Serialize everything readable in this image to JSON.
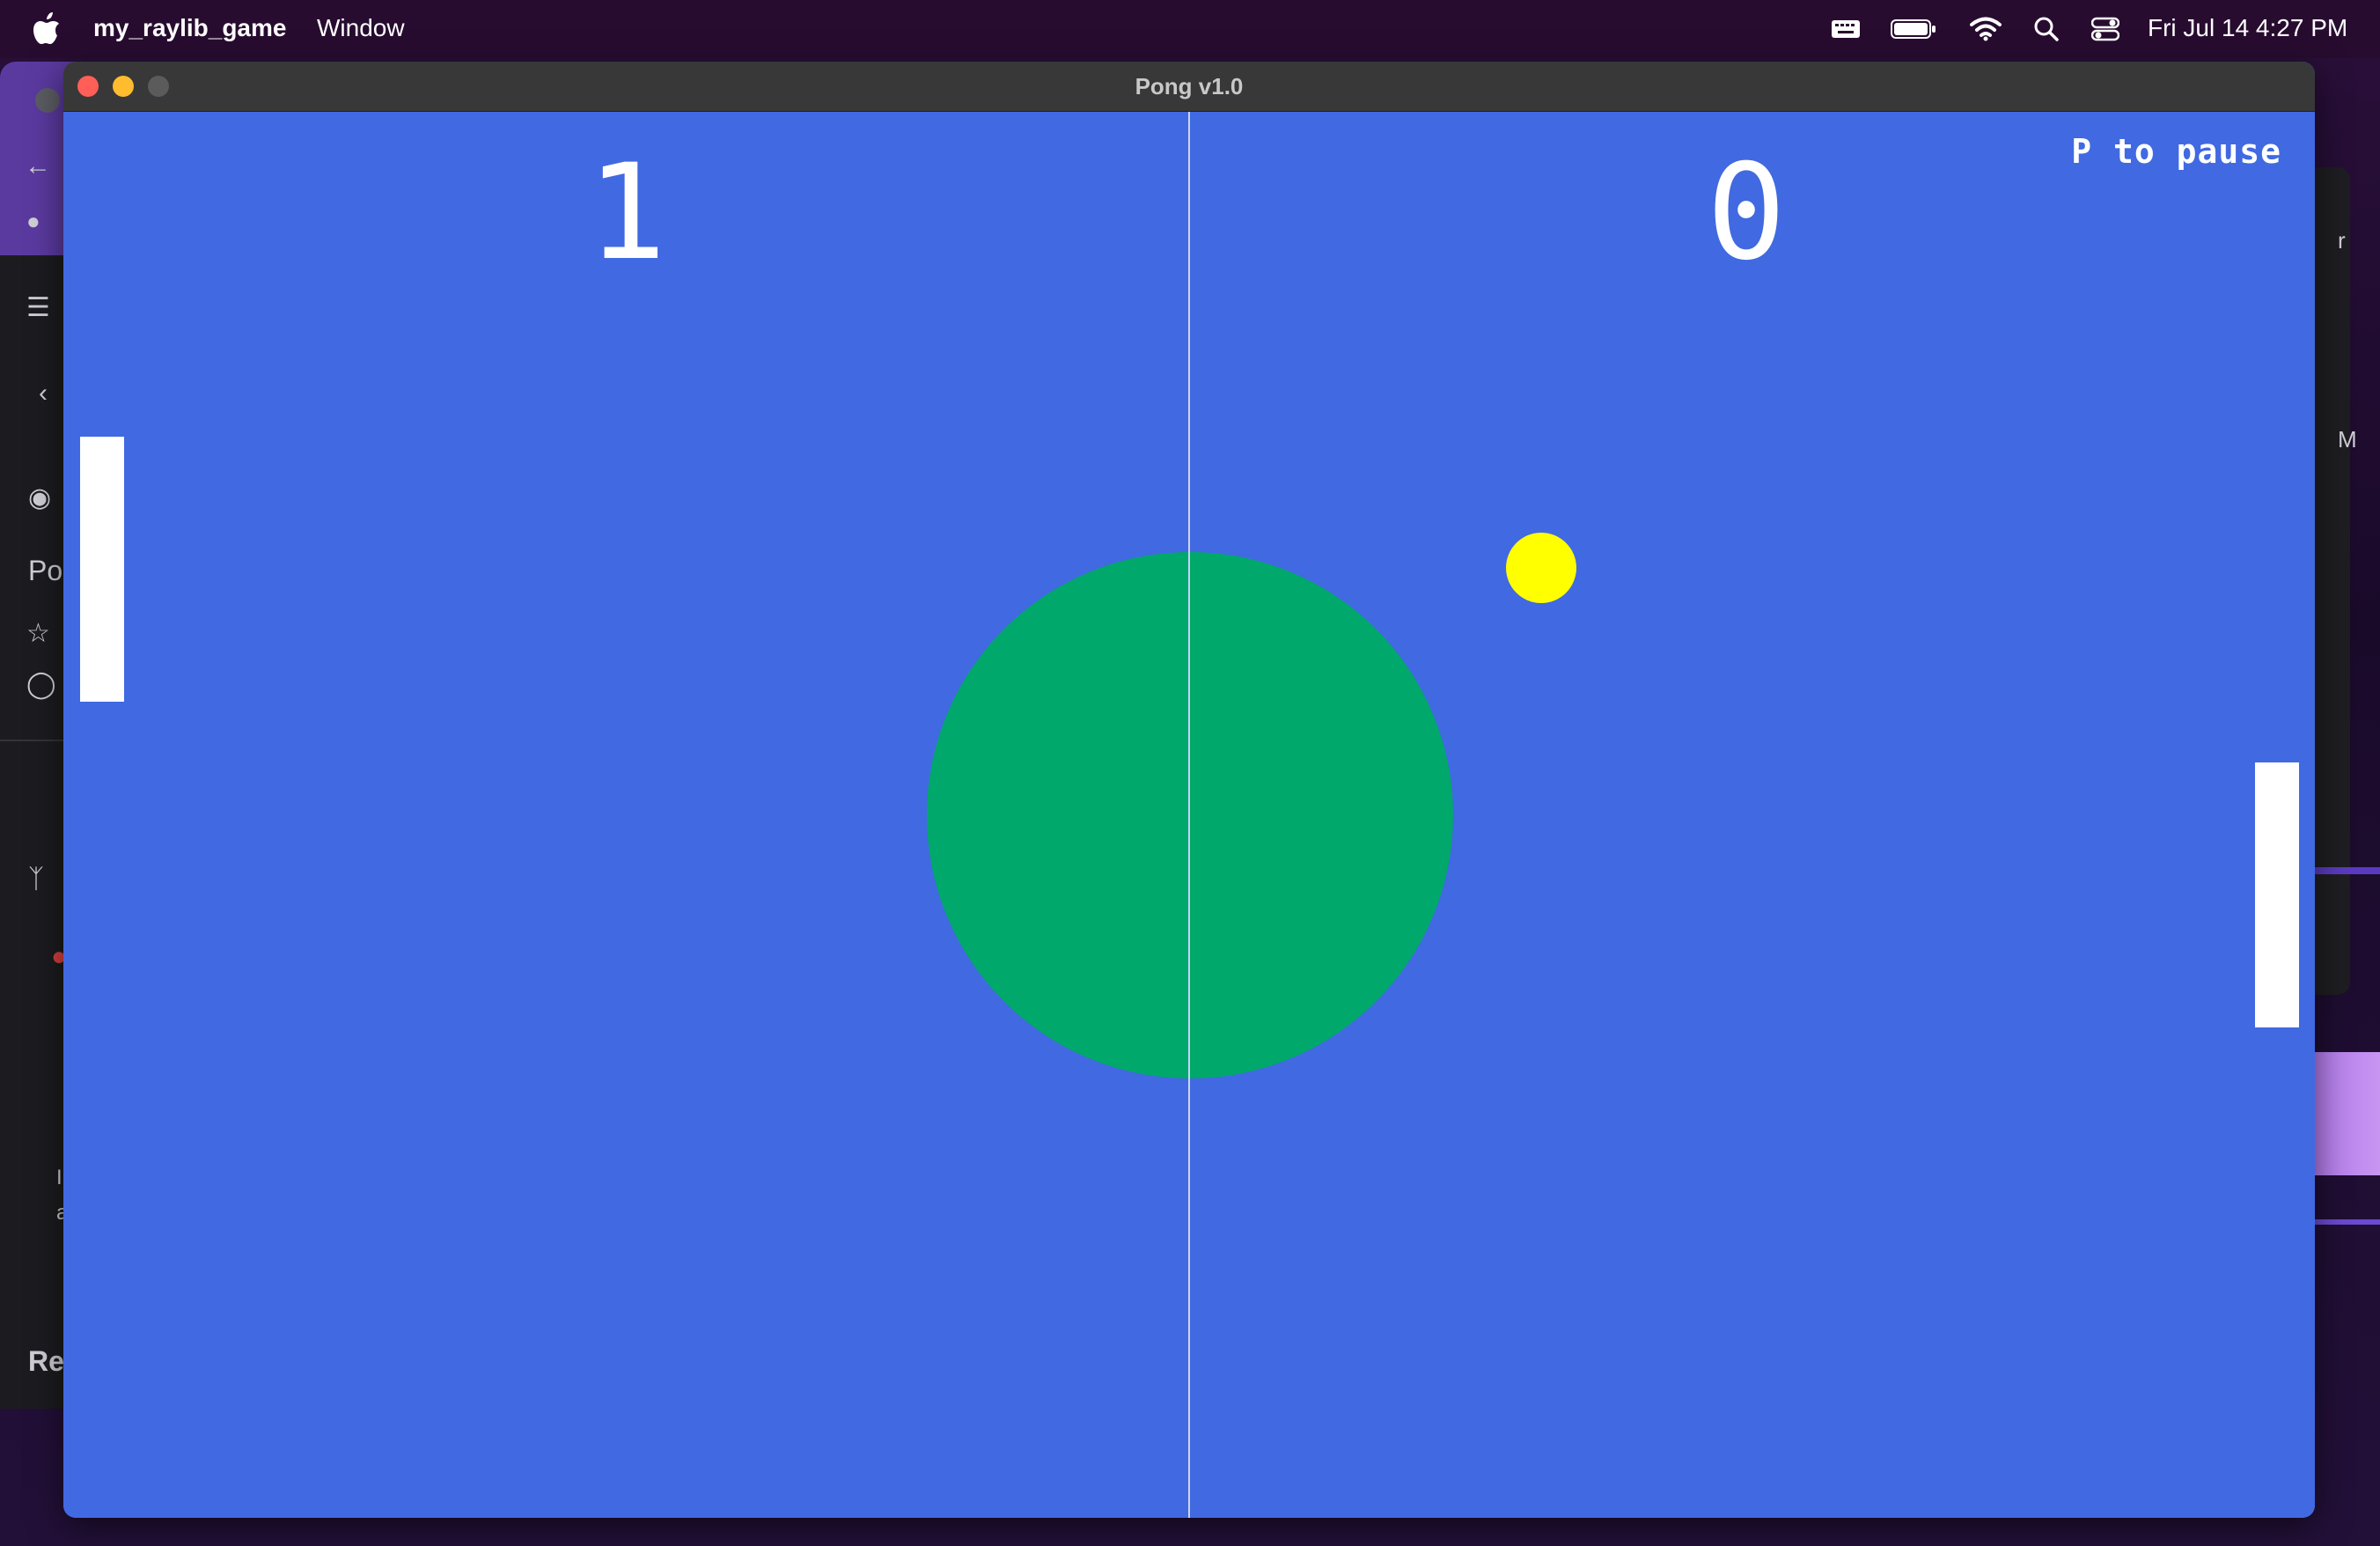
{
  "menubar": {
    "app_name": "my_raylib_game",
    "menu_window": "Window",
    "clock": "Fri Jul 14  4:27 PM",
    "status_icons": [
      "keyboard-icon",
      "battery-icon",
      "wifi-icon",
      "search-icon",
      "control-center-icon"
    ]
  },
  "window": {
    "title": "Pong v1.0",
    "background_color": "#4169e1"
  },
  "game": {
    "score_left": "1",
    "score_right": "0",
    "pause_hint": "P to pause",
    "colors": {
      "field": "#4169e1",
      "center_circle": "#00a86b",
      "ball": "#ffff00",
      "paddles": "#ffffff",
      "center_line": "#c9d4f5"
    }
  },
  "background_app": {
    "left_text_1": "Po",
    "left_text_2": "Re",
    "left_text_3": "I",
    "left_text_4": "a",
    "right_text_1": "r",
    "right_text_2": "M"
  }
}
